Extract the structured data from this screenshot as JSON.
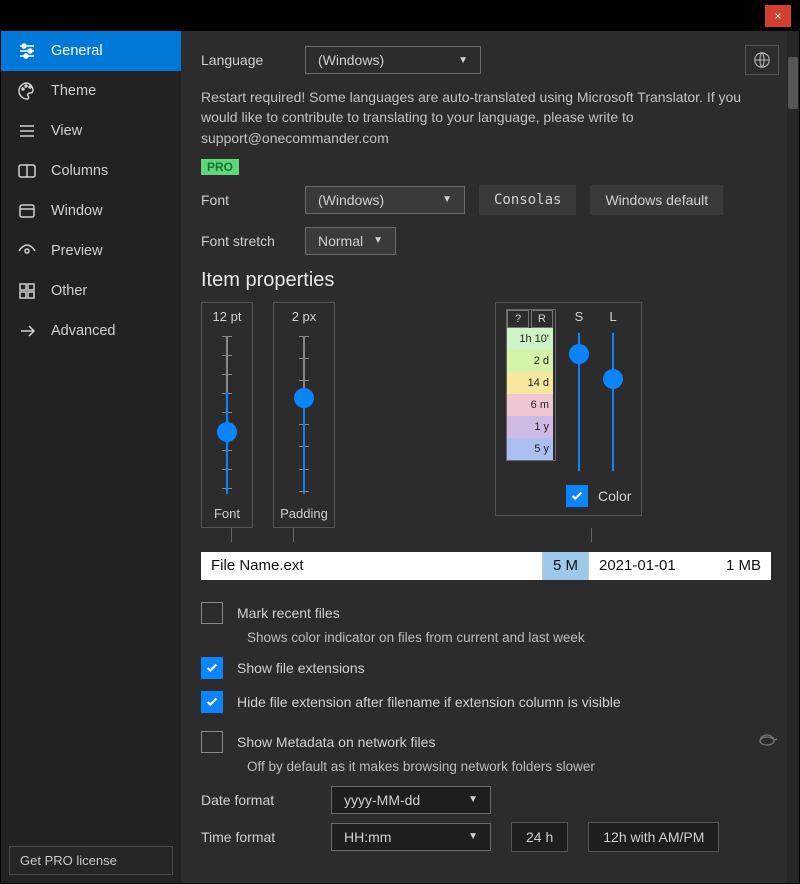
{
  "titlebar": {
    "close_glyph": "×"
  },
  "sidebar": {
    "items": [
      {
        "label": "General"
      },
      {
        "label": "Theme"
      },
      {
        "label": "View"
      },
      {
        "label": "Columns"
      },
      {
        "label": "Window"
      },
      {
        "label": "Preview"
      },
      {
        "label": "Other"
      },
      {
        "label": "Advanced"
      }
    ],
    "pro_button": "Get PRO license"
  },
  "general": {
    "language_label": "Language",
    "language_value": "(Windows)",
    "restart_hint": "Restart required! Some languages are auto-translated using Microsoft Translator. If you would like to contribute to translating to your language, please write to support@onecommander.com",
    "pro_badge": "PRO",
    "font_label": "Font",
    "font_value": "(Windows)",
    "font_btn_consolas": "Consolas",
    "font_btn_default": "Windows default",
    "font_stretch_label": "Font stretch",
    "font_stretch_value": "Normal"
  },
  "item_props": {
    "title": "Item properties",
    "font_value": "12 pt",
    "font_label": "Font",
    "padding_value": "2 px",
    "padding_label": "Padding",
    "color_q": "?",
    "color_r": "R",
    "color_s": "S",
    "color_l": "L",
    "scale": [
      "1h 10'",
      "2 d",
      "14 d",
      "6 m",
      "1 y",
      "5 y"
    ],
    "scale_colors": [
      "#cdf3c6",
      "#d4f2a8",
      "#f5e79d",
      "#f1c6d4",
      "#cfb9e5",
      "#aabff0"
    ],
    "color_label": "Color",
    "preview": {
      "name": "File Name.ext",
      "mod": "5 M",
      "date": "2021-01-01",
      "size": "1 MB"
    }
  },
  "options": {
    "mark_recent": "Mark recent files",
    "mark_recent_desc": "Shows color indicator on files from current and last week",
    "show_ext": "Show file extensions",
    "hide_ext": "Hide file extension after filename if extension column is visible",
    "show_meta": "Show Metadata on network files",
    "show_meta_desc": "Off by default as it makes browsing network folders slower",
    "date_format_label": "Date format",
    "date_format_value": "yyyy-MM-dd",
    "time_format_label": "Time format",
    "time_format_value": "HH:mm",
    "time_24h": "24 h",
    "time_12h": "12h with AM/PM"
  }
}
